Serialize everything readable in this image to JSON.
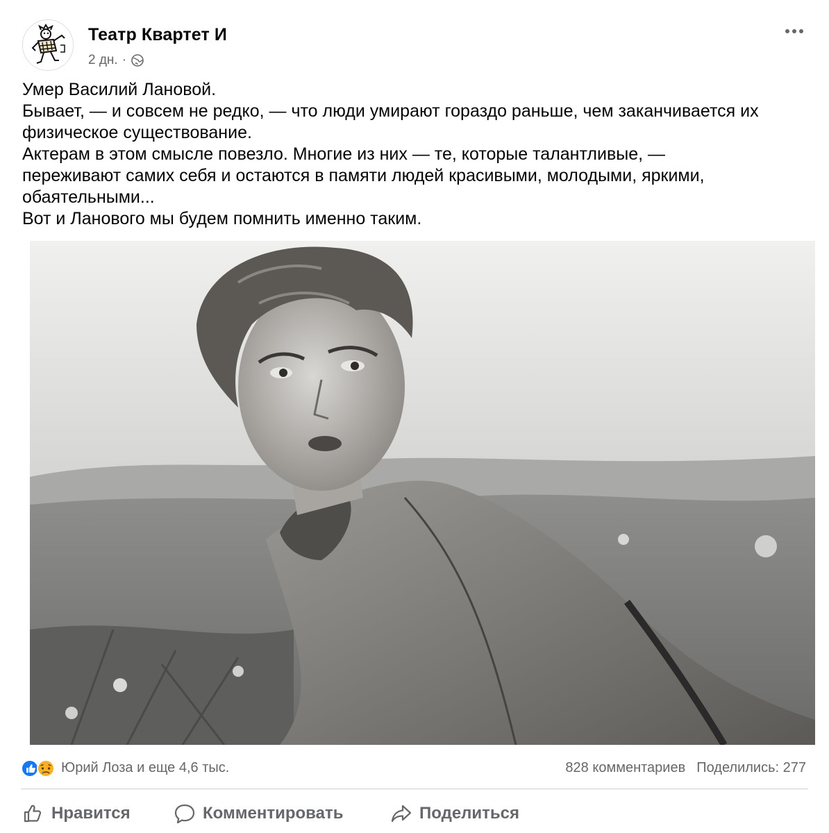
{
  "post": {
    "page_name": "Театр Квартет И",
    "time": "2 дн.",
    "separator": "·",
    "text_lines": [
      "Умер Василий Лановой.",
      "Бывает, — и совсем не редко, — что люди умирают гораздо раньше, чем заканчивается их",
      "физическое существование.",
      "Актерам в этом смысле повезло. Многие из них — те, которые талантливые, —",
      "переживают самих себя и остаются в памяти людей красивыми, молодыми, яркими,",
      "обаятельными...",
      "Вот и Ланового мы будем помнить именно таким."
    ]
  },
  "reactions": {
    "names": "Юрий Лоза и еще 4,6 тыс.",
    "comments": "828 комментариев",
    "shares": "Поделились: 277"
  },
  "actions": {
    "like": "Нравится",
    "comment": "Комментировать",
    "share": "Поделиться"
  },
  "icons": [
    "page-logo-icon",
    "globe-icon",
    "more-options-icon",
    "like-reaction-icon",
    "sad-reaction-icon",
    "thumbs-up-icon",
    "comment-bubble-icon",
    "share-arrow-icon"
  ],
  "colors": {
    "like_blue": "#1877f2",
    "sad_yellow": "#f7b125",
    "secondary_text": "#65676b"
  }
}
